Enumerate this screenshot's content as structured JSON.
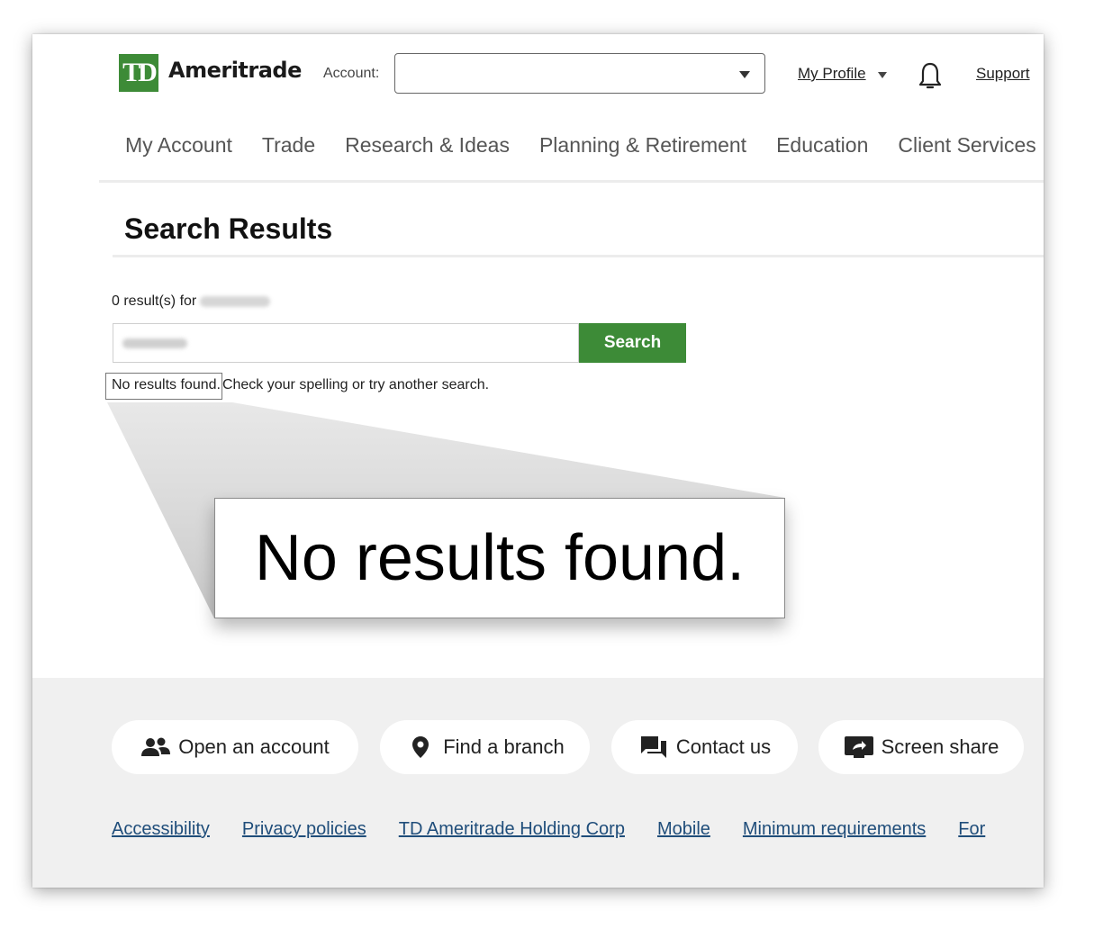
{
  "header": {
    "logo_mark": "TD",
    "logo_text": "Ameritrade",
    "account_label": "Account:",
    "account_value": "",
    "my_profile": "My Profile",
    "support": "Support"
  },
  "nav": {
    "items": [
      "My Account",
      "Trade",
      "Research & Ideas",
      "Planning & Retirement",
      "Education",
      "Client Services"
    ]
  },
  "main": {
    "title": "Search Results",
    "result_count": "0 result(s) for",
    "search_button": "Search",
    "no_results": "No results found.",
    "hint": "Check your spelling or try another search."
  },
  "callout": {
    "text": "No results found."
  },
  "footer": {
    "actions": [
      "Open an account",
      "Find a branch",
      "Contact us",
      "Screen share"
    ],
    "links": [
      "Accessibility",
      "Privacy policies",
      "TD Ameritrade Holding Corp",
      "Mobile",
      "Minimum requirements",
      "For"
    ]
  },
  "colors": {
    "brand_green": "#3d8b37",
    "link_blue": "#1f4d7a",
    "footer_bg": "#f0f0f0"
  }
}
